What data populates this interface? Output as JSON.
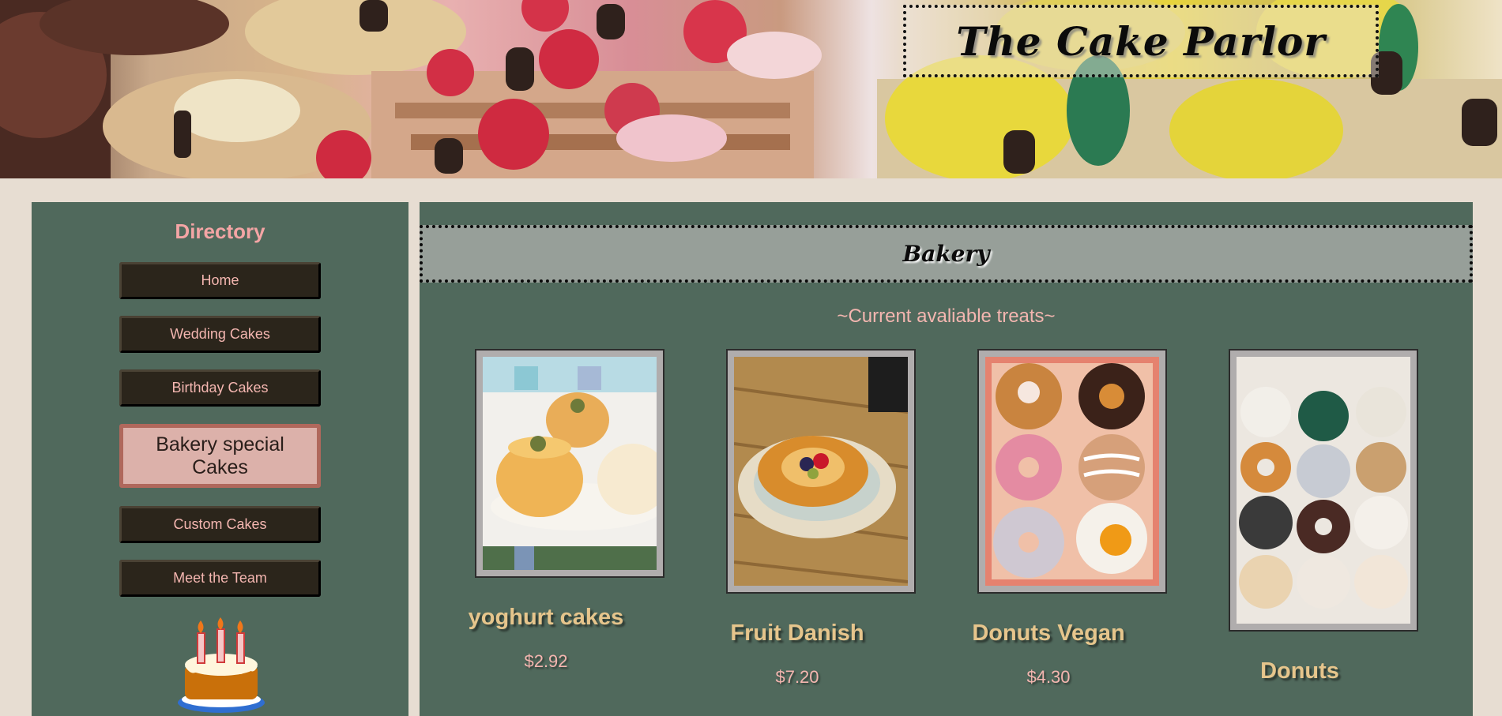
{
  "header": {
    "site_title": "The Cake Parlor"
  },
  "sidebar": {
    "title": "Directory",
    "items": [
      {
        "label": "Home"
      },
      {
        "label": "Wedding Cakes"
      },
      {
        "label": "Birthday Cakes"
      },
      {
        "label": "Bakery special Cakes",
        "active": true
      },
      {
        "label": "Custom Cakes"
      },
      {
        "label": "Meet the Team"
      }
    ]
  },
  "main": {
    "section_title": "Bakery",
    "subtitle": "~Current avaliable treats~",
    "products": [
      {
        "name": "yoghurt cakes",
        "price": "$2.92"
      },
      {
        "name": "Fruit Danish",
        "price": "$7.20"
      },
      {
        "name": "Donuts Vegan",
        "price": "$4.30"
      },
      {
        "name": "Donuts",
        "price": ""
      }
    ]
  },
  "colors": {
    "page_bg": "#e7ddd2",
    "panel_bg": "#50695c",
    "nav_button": "#2b251b",
    "nav_active": "#dcb1aa",
    "accent_pink": "#f4a5a5",
    "product_name": "#e6c58c"
  }
}
